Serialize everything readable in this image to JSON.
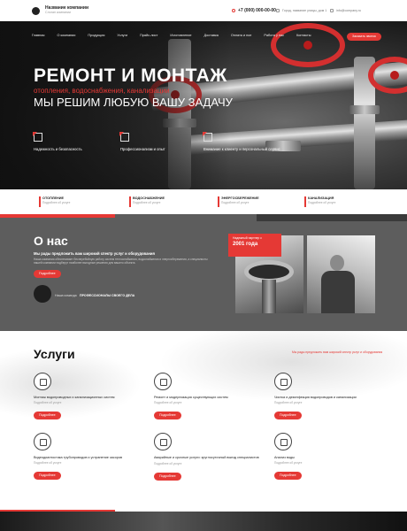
{
  "brand": {
    "name": "Название компании",
    "subtitle": "Слоган компании"
  },
  "contacts": {
    "phone": "+7 (000) 000-00-00",
    "address": "Город, название улицы, дом 1",
    "email": "info@company.ru"
  },
  "nav": [
    "Главная",
    "О компании",
    "Продукция",
    "Услуги",
    "Прайс-лист",
    "Изготовление",
    "Доставка",
    "Оплата и пое",
    "Работа у нас",
    "Контакты"
  ],
  "nav_cta": "Заказать звонок",
  "hero": {
    "title": "РЕМОНТ И МОНТАЖ",
    "subtitle": "отопления, водоснабжения, канализации",
    "tagline": "МЫ РЕШИМ ЛЮБУЮ ВАШУ ЗАДАЧУ",
    "features": [
      {
        "label": "Надежность и безопасность",
        "icon": "building-icon"
      },
      {
        "label": "Профессионализм и опыт",
        "icon": "certificate-icon"
      },
      {
        "label": "Внимание к клиенту и персональный сервис",
        "icon": "client-icon"
      }
    ]
  },
  "strip": [
    {
      "title": "ОТОПЛЕНИЕ",
      "sub": "Подробнее об услуге"
    },
    {
      "title": "ВОДОСНАБЖЕНИЕ",
      "sub": "Подробнее об услуге"
    },
    {
      "title": "ЭНЕРГОСБЕРЕЖЕНИЕ",
      "sub": "Подробнее об услуге"
    },
    {
      "title": "КАНАЛИЗАЦИЯ",
      "sub": "Подробнее об услуге"
    }
  ],
  "about": {
    "heading": "О нас",
    "lead": "Мы рады предложить вам широкий спектр услуг и оборудования",
    "text": "Наша компания обеспечивает бесперебойную работу систем теплоснабжения, водоснабжения и энергосбережения, а специалисты нашей компании подберут наиболее выгодные решения для вашего объекта.",
    "button": "Подробнее",
    "team_label": "Наша команда",
    "team_link": "ПРОФЕССИОНАЛЫ СВОЕГО ДЕЛА",
    "partner_label": "Надежный партнер с",
    "partner_year": "2001 года"
  },
  "services": {
    "heading": "Услуги",
    "cta": "Мы рады предложить вам широкий спектр услуг и оборудования",
    "items": [
      {
        "title": "Монтаж водопроводных и канализационных систем",
        "sub": "Подробнее об услуге",
        "button": "Подробнее",
        "icon": "pipe-icon"
      },
      {
        "title": "Ремонт и модернизация существующих систем",
        "sub": "Подробнее об услуге",
        "button": "Подробнее",
        "icon": "repair-icon"
      },
      {
        "title": "Чистка и дезинфекция водопроводов и канализации",
        "sub": "Подробнее об услуге",
        "button": "Подробнее",
        "icon": "cleaning-icon"
      },
      {
        "title": "Видеодиагностика трубопроводов и устранение засоров",
        "sub": "Подробнее об услуге",
        "button": "Подробнее",
        "icon": "video-icon"
      },
      {
        "title": "Аварийные и срочные услуги: круглосуточный выезд специалистов",
        "sub": "Подробнее об услуге",
        "button": "Подробнее",
        "icon": "emergency-icon"
      },
      {
        "title": "Анализ воды",
        "sub": "Подробнее об услуге",
        "button": "Подробнее",
        "icon": "water-analysis-icon"
      }
    ]
  }
}
